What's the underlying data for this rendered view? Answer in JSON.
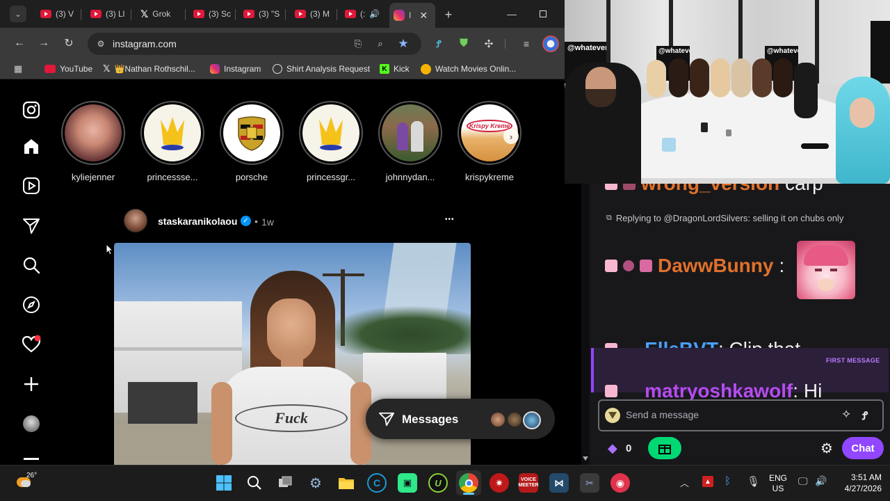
{
  "browser": {
    "tabs": [
      {
        "label": "(3) V"
      },
      {
        "label": "(3) Ll"
      },
      {
        "label": "Grok"
      },
      {
        "label": "(3) Sc"
      },
      {
        "label": "(3) \"S"
      },
      {
        "label": "(3) M"
      },
      {
        "label": "(:"
      },
      {
        "label": "I"
      }
    ],
    "new_tab": "+",
    "url": "instagram.com",
    "bookmarks": [
      {
        "label": "YouTube"
      },
      {
        "label": "👑Nathan Rothschil..."
      },
      {
        "label": "Instagram"
      },
      {
        "label": "Shirt Analysis Request"
      },
      {
        "label": "Kick"
      },
      {
        "label": "Watch Movies Onlin..."
      }
    ]
  },
  "instagram": {
    "stories": [
      {
        "name": "kyliejenner"
      },
      {
        "name": "princessse..."
      },
      {
        "name": "porsche"
      },
      {
        "name": "princessgr..."
      },
      {
        "name": "johnnydan..."
      },
      {
        "name": "krispykreme"
      }
    ],
    "post": {
      "username": "staskaranikolaou",
      "separator": "•",
      "time": "1w",
      "more": "•••"
    },
    "messages_label": "Messages",
    "krispy_sign": "Krispy Kreme",
    "shirt_text": "Fuck"
  },
  "stream": {
    "wall_text": "@whatever"
  },
  "chat": {
    "partial_user": "wrong_version",
    "partial_text": "carp",
    "reply_note": "Replying to @DragonLordSilvers: selling it on chubs only",
    "messages": [
      {
        "user": "DawwBunny",
        "sep": ":",
        "text": "",
        "color": "#e0702a"
      },
      {
        "user": "ElleBVT",
        "sep": ":",
        "text": " Clip that",
        "color": "#4aa0ff"
      },
      {
        "user": "matryoshkawolf",
        "sep": ":",
        "text": " Hi",
        "color": "#b54cf0"
      }
    ],
    "first_message_badge": "FIRST MESSAGE",
    "input_placeholder": "Send a message",
    "points": "0",
    "chat_button": "Chat",
    "accent": "#9146ff"
  },
  "taskbar": {
    "weather_temp": "26°",
    "lang_top": "ENG",
    "lang_bottom": "US",
    "time": "3:51 AM",
    "date": "4/27/2026",
    "voicemeeter": "VOICE MEETER"
  }
}
